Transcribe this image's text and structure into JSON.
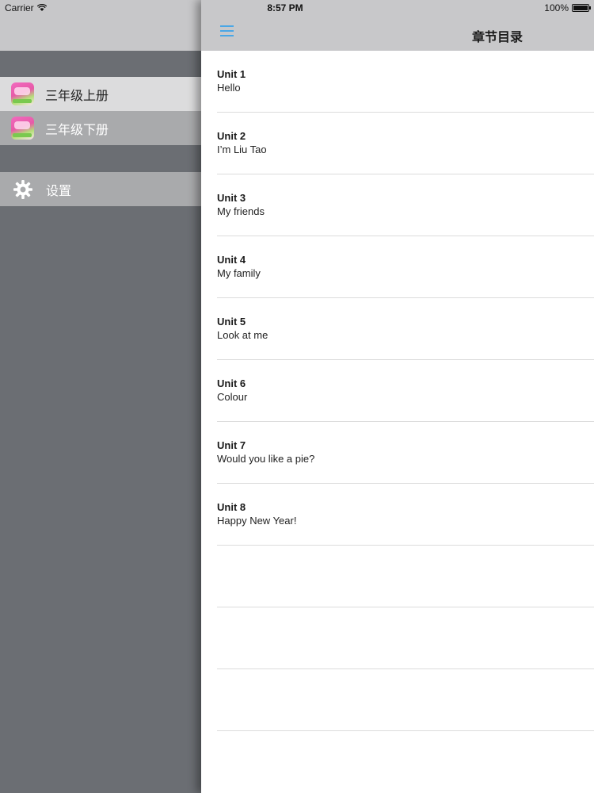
{
  "status_bar": {
    "carrier": "Carrier",
    "time": "8:57 PM",
    "battery": "100%"
  },
  "sidebar": {
    "items": [
      {
        "label": "三年级上册",
        "icon": "book-cover-icon",
        "selected": true
      },
      {
        "label": "三年级下册",
        "icon": "book-cover-icon",
        "selected": false
      }
    ],
    "settings_label": "设置"
  },
  "navbar": {
    "title": "章节目录"
  },
  "units": [
    {
      "title": "Unit 1",
      "subtitle": "Hello"
    },
    {
      "title": "Unit 2",
      "subtitle": "I’m Liu Tao"
    },
    {
      "title": "Unit 3",
      "subtitle": "My friends"
    },
    {
      "title": "Unit 4",
      "subtitle": "My family"
    },
    {
      "title": "Unit 5",
      "subtitle": "Look at me"
    },
    {
      "title": "Unit 6",
      "subtitle": "Colour"
    },
    {
      "title": "Unit 7",
      "subtitle": "Would you like a pie?"
    },
    {
      "title": "Unit 8",
      "subtitle": "Happy New Year!"
    }
  ],
  "colors": {
    "accent": "#4aa7e6",
    "sidebar_bg": "#6b6e73",
    "navbar_bg": "#c8c8ca"
  }
}
